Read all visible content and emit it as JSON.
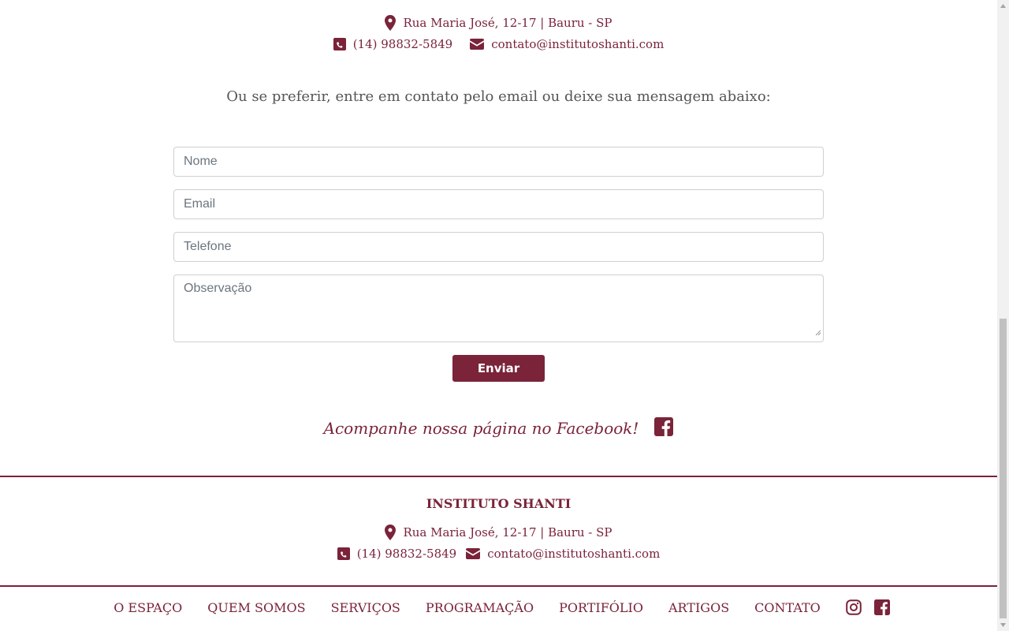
{
  "top_contact": {
    "address": "Rua Maria José, 12-17 | Bauru - SP",
    "phone": "(14) 98832-5849",
    "email": "contato@institutoshanti.com"
  },
  "intro_text": "Ou se preferir, entre em contato pelo email ou deixe sua mensagem abaixo:",
  "form": {
    "name_placeholder": "Nome",
    "email_placeholder": "Email",
    "phone_placeholder": "Telefone",
    "notes_placeholder": "Observação",
    "submit_label": "Enviar"
  },
  "facebook_cta": "Acompanhe nossa página no Facebook!",
  "footer": {
    "title": "INSTITUTO SHANTI",
    "address": "Rua Maria José, 12-17 | Bauru - SP",
    "phone": "(14) 98832-5849",
    "email": "contato@institutoshanti.com"
  },
  "nav": {
    "items": [
      "O ESPAÇO",
      "QUEM SOMOS",
      "SERVIÇOS",
      "PROGRAMAÇÃO",
      "PORTIFÓLIO",
      "ARTIGOS",
      "CONTATO"
    ]
  },
  "icons": {
    "location": "map-marker-icon",
    "phone": "phone-square-icon",
    "email": "envelope-icon",
    "facebook": "facebook-square-icon",
    "instagram": "instagram-icon"
  },
  "colors": {
    "brand": "#7a2339",
    "muted_text": "#555555",
    "placeholder": "#6c757d"
  }
}
